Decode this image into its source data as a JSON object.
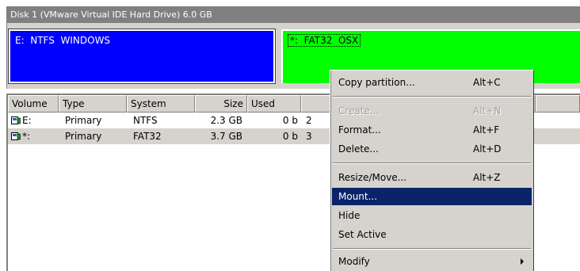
{
  "disk": {
    "title": "Disk 1 (VMware Virtual IDE Hard Drive) 6.0 GB",
    "partitions": [
      {
        "label": "E:  NTFS  WINDOWS",
        "color": "#0000ff"
      },
      {
        "label": "*:  FAT32  OSX",
        "color": "#00ff00"
      }
    ]
  },
  "list": {
    "columns": [
      "Volume",
      "Type",
      "System",
      "Size",
      "Used"
    ],
    "rows": [
      {
        "volume": "E:",
        "type": "Primary",
        "system": "NTFS",
        "size": "2.3 GB",
        "used": "0 b",
        "extra": "2"
      },
      {
        "volume": "*:",
        "type": "Primary",
        "system": "FAT32",
        "size": "3.7 GB",
        "used": "0 b",
        "extra": "3"
      }
    ],
    "selected_row": 1
  },
  "menu": {
    "items": [
      {
        "label": "Copy partition...",
        "shortcut": "Alt+C"
      },
      {
        "label": "Create...",
        "shortcut": "Alt+N",
        "disabled": true
      },
      {
        "label": "Format...",
        "shortcut": "Alt+F"
      },
      {
        "label": "Delete...",
        "shortcut": "Alt+D"
      },
      {
        "label": "Resize/Move...",
        "shortcut": "Alt+Z"
      },
      {
        "label": "Mount...",
        "highlighted": true
      },
      {
        "label": "Hide"
      },
      {
        "label": "Set Active"
      },
      {
        "label": "Modify",
        "submenu": true
      }
    ]
  },
  "colors": {
    "highlight": "#0a246a",
    "panel_gray": "#d6d3ce"
  }
}
